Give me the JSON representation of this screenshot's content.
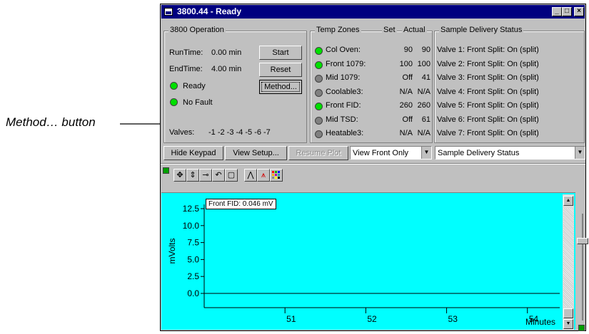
{
  "callout": {
    "text": "Method… button"
  },
  "window": {
    "title": "3800.44 - Ready",
    "controls": {
      "minimize": "_",
      "maximize": "□",
      "close": "×"
    }
  },
  "operation": {
    "group_label": "3800 Operation",
    "runtime_label": "RunTime:",
    "runtime_value": "0.00 min",
    "endtime_label": "EndTime:",
    "endtime_value": "4.00 min",
    "status_ready": "Ready",
    "status_fault": "No Fault",
    "valves_label": "Valves:",
    "valves_value": "-1 -2 -3 -4 -5 -6 -7",
    "start_label": "Start",
    "reset_label": "Reset",
    "method_label": "Method..."
  },
  "temp_zones": {
    "group_label": "Temp Zones",
    "header_set": "Set",
    "header_actual": "Actual",
    "rows": [
      {
        "name": "Col Oven:",
        "set": "90",
        "actual": "90",
        "led": "green"
      },
      {
        "name": "Front 1079:",
        "set": "100",
        "actual": "100",
        "led": "green"
      },
      {
        "name": "Mid 1079:",
        "set": "Off",
        "actual": "41",
        "led": "gray"
      },
      {
        "name": "Coolable3:",
        "set": "N/A",
        "actual": "N/A",
        "led": "gray"
      },
      {
        "name": "Front FID:",
        "set": "260",
        "actual": "260",
        "led": "green"
      },
      {
        "name": "Mid TSD:",
        "set": "Off",
        "actual": "61",
        "led": "gray"
      },
      {
        "name": "Heatable3:",
        "set": "N/A",
        "actual": "N/A",
        "led": "gray"
      }
    ]
  },
  "delivery": {
    "group_label": "Sample Delivery Status",
    "rows": [
      "Valve 1: Front Split: On (split)",
      "Valve 2: Front Split: On (split)",
      "Valve 3: Front Split: On (split)",
      "Valve 4: Front Split: On (split)",
      "Valve 5: Front Split: On (split)",
      "Valve 6: Front Split: On (split)",
      "Valve 7: Front Split: On (split)"
    ]
  },
  "button_bar": {
    "hide_keypad": "Hide Keypad",
    "view_setup": "View Setup...",
    "resume_plot": "Resume Plot",
    "view_select": "View Front Only",
    "status_select": "Sample Delivery Status"
  },
  "toolbar": {
    "icons": [
      "move-icon",
      "scale-icon",
      "connect-icon",
      "undo-zoom-icon",
      "overlay-icon",
      "peak-icon",
      "baseline-icon",
      "color-palette-icon"
    ]
  },
  "colors": {
    "plot_background": "#00ffff",
    "title_bar": "#000080",
    "led_on": "#00e000",
    "led_off": "#808080"
  },
  "chart_data": {
    "type": "line",
    "readout": "Front FID: 0.046 mV",
    "ylabel": "mVolts",
    "xlabel": "Minutes",
    "y_ticks": [
      "12.5",
      "10.0",
      "7.5",
      "5.0",
      "2.5",
      "0.0"
    ],
    "x_ticks": [
      "51",
      "52",
      "53",
      "54"
    ],
    "ylim": [
      0,
      12.5
    ],
    "xlim": [
      50,
      54.4
    ],
    "series": [
      {
        "x": [
          50.0,
          54.4
        ],
        "y": [
          0.0,
          0.0
        ]
      }
    ]
  }
}
